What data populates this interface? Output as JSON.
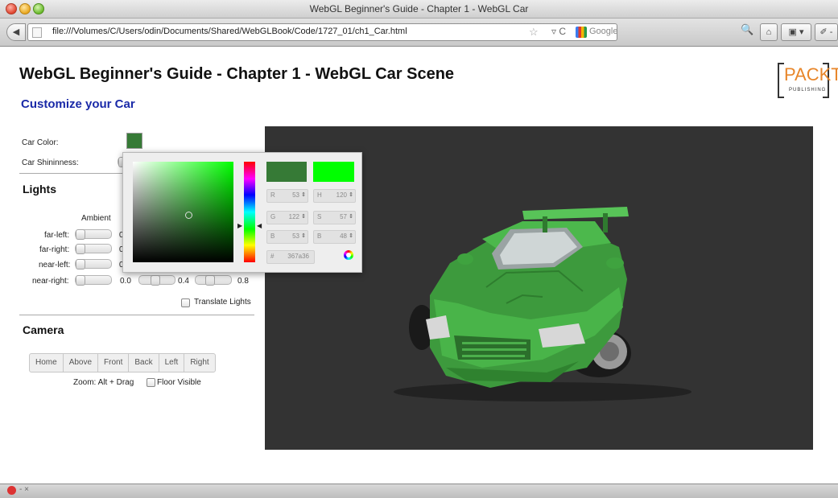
{
  "window": {
    "title": "WebGL Beginner's Guide - Chapter 1 - WebGL Car"
  },
  "browser": {
    "url": "file:///Volumes/C/Users/odin/Documents/Shared/WebGLBook/Code/1727_01/ch1_Car.html",
    "search_placeholder": "Google",
    "back_glyph": "◀",
    "star_glyph": "☆",
    "reload_glyph": "▿ C",
    "magnifier_glyph": "🔍",
    "home_glyph": "⌂",
    "bookmarks_glyph": "▣ ▾",
    "extra_glyph": "✐ -"
  },
  "page": {
    "title": "WebGL Beginner's Guide - Chapter 1 - WebGL Car Scene",
    "subtitle": "Customize your Car",
    "logo_word": "PACKT",
    "logo_sub": "PUBLISHING"
  },
  "controls": {
    "car_color_label": "Car Color:",
    "car_shininess_label": "Car Shininness:",
    "car_color_hex": "#367a36"
  },
  "lights": {
    "heading": "Lights",
    "ambient_label": "Ambient",
    "rows": [
      {
        "label": "far-left:",
        "v1": "0"
      },
      {
        "label": "far-right:",
        "v1": "0"
      },
      {
        "label": "near-left:",
        "v1": "0"
      },
      {
        "label": "near-right:",
        "v1": "0.0",
        "v2": "0.4",
        "v3": "0.8"
      }
    ],
    "translate_label": "Translate Lights"
  },
  "camera": {
    "heading": "Camera",
    "buttons": [
      "Home",
      "Above",
      "Front",
      "Back",
      "Left",
      "Right"
    ],
    "zoom_label": "Zoom: Alt + Drag",
    "floor_label": "Floor Visible"
  },
  "color_picker": {
    "fields": {
      "R": {
        "key": "R",
        "value": "53"
      },
      "G": {
        "key": "G",
        "value": "122"
      },
      "B": {
        "key": "B",
        "value": "53"
      },
      "H": {
        "key": "H",
        "value": "120"
      },
      "S": {
        "key": "S",
        "value": "57"
      },
      "Bv": {
        "key": "B",
        "value": "48"
      },
      "hex": {
        "key": "#",
        "value": "367a36"
      }
    },
    "arrow_glyph": "⇕",
    "new_color": "#367a36",
    "current_color": "#00ff00"
  },
  "statusbar": {
    "text": "- ×"
  }
}
